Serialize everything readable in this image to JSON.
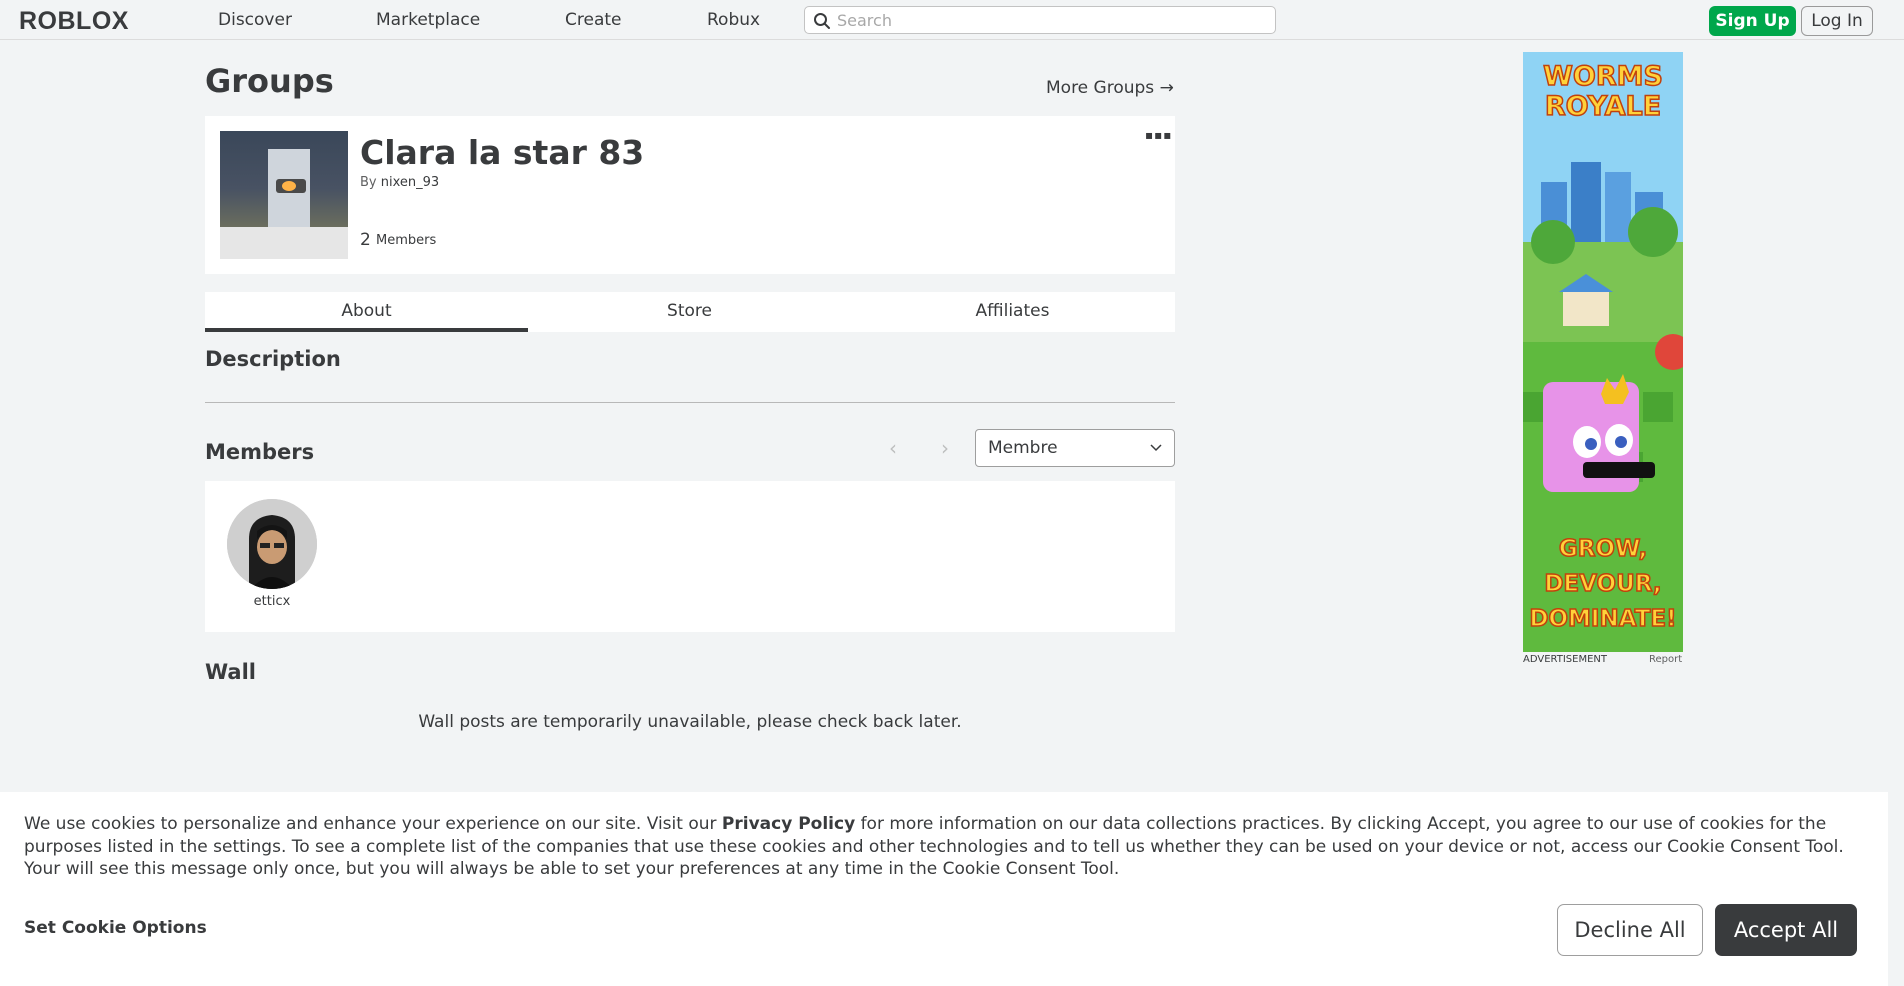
{
  "nav": {
    "logo": "RОBLOX",
    "links": [
      "Discover",
      "Marketplace",
      "Create",
      "Robux"
    ],
    "search_placeholder": "Search",
    "signup": "Sign Up",
    "login": "Log In"
  },
  "page": {
    "title": "Groups",
    "more_groups": "More Groups →"
  },
  "group": {
    "name": "Clara la star 83",
    "by_prefix": "By",
    "owner": "nixen_93",
    "member_count": "2",
    "member_count_label": "Members",
    "more_icon": "ellipsis-icon"
  },
  "tabs": [
    "About",
    "Store",
    "Affiliates"
  ],
  "description": {
    "heading": "Description"
  },
  "members": {
    "heading": "Members",
    "role_selected": "Membre",
    "list": [
      {
        "name": "etticx"
      }
    ]
  },
  "wall": {
    "heading": "Wall",
    "message": "Wall posts are temporarily unavailable, please check back later."
  },
  "ad": {
    "title_line1": "WORMS",
    "title_line2": "ROYALE",
    "tag_line1": "GROW,",
    "tag_line2": "DEVOUR,",
    "tag_line3": "DOMINATE!",
    "label": "ADVERTISEMENT",
    "report": "Report"
  },
  "cookie": {
    "text_before": "We use cookies to personalize and enhance your experience on our site. Visit our ",
    "link": "Privacy Policy",
    "text_after": " for more information on our data collections practices. By clicking Accept, you agree to our use of cookies for the purposes listed in the settings. To see a complete list of the companies that use these cookies and other technologies and to tell us whether they can be used on your device or not, access our Cookie Consent Tool. Your will see this message only once, but you will always be able to set your preferences at any time in the Cookie Consent Tool.",
    "options": "Set Cookie Options",
    "decline": "Decline All",
    "accept": "Accept All"
  },
  "colors": {
    "accent_green": "#00a74b",
    "text": "#393b3d",
    "bg": "#f2f4f5"
  }
}
